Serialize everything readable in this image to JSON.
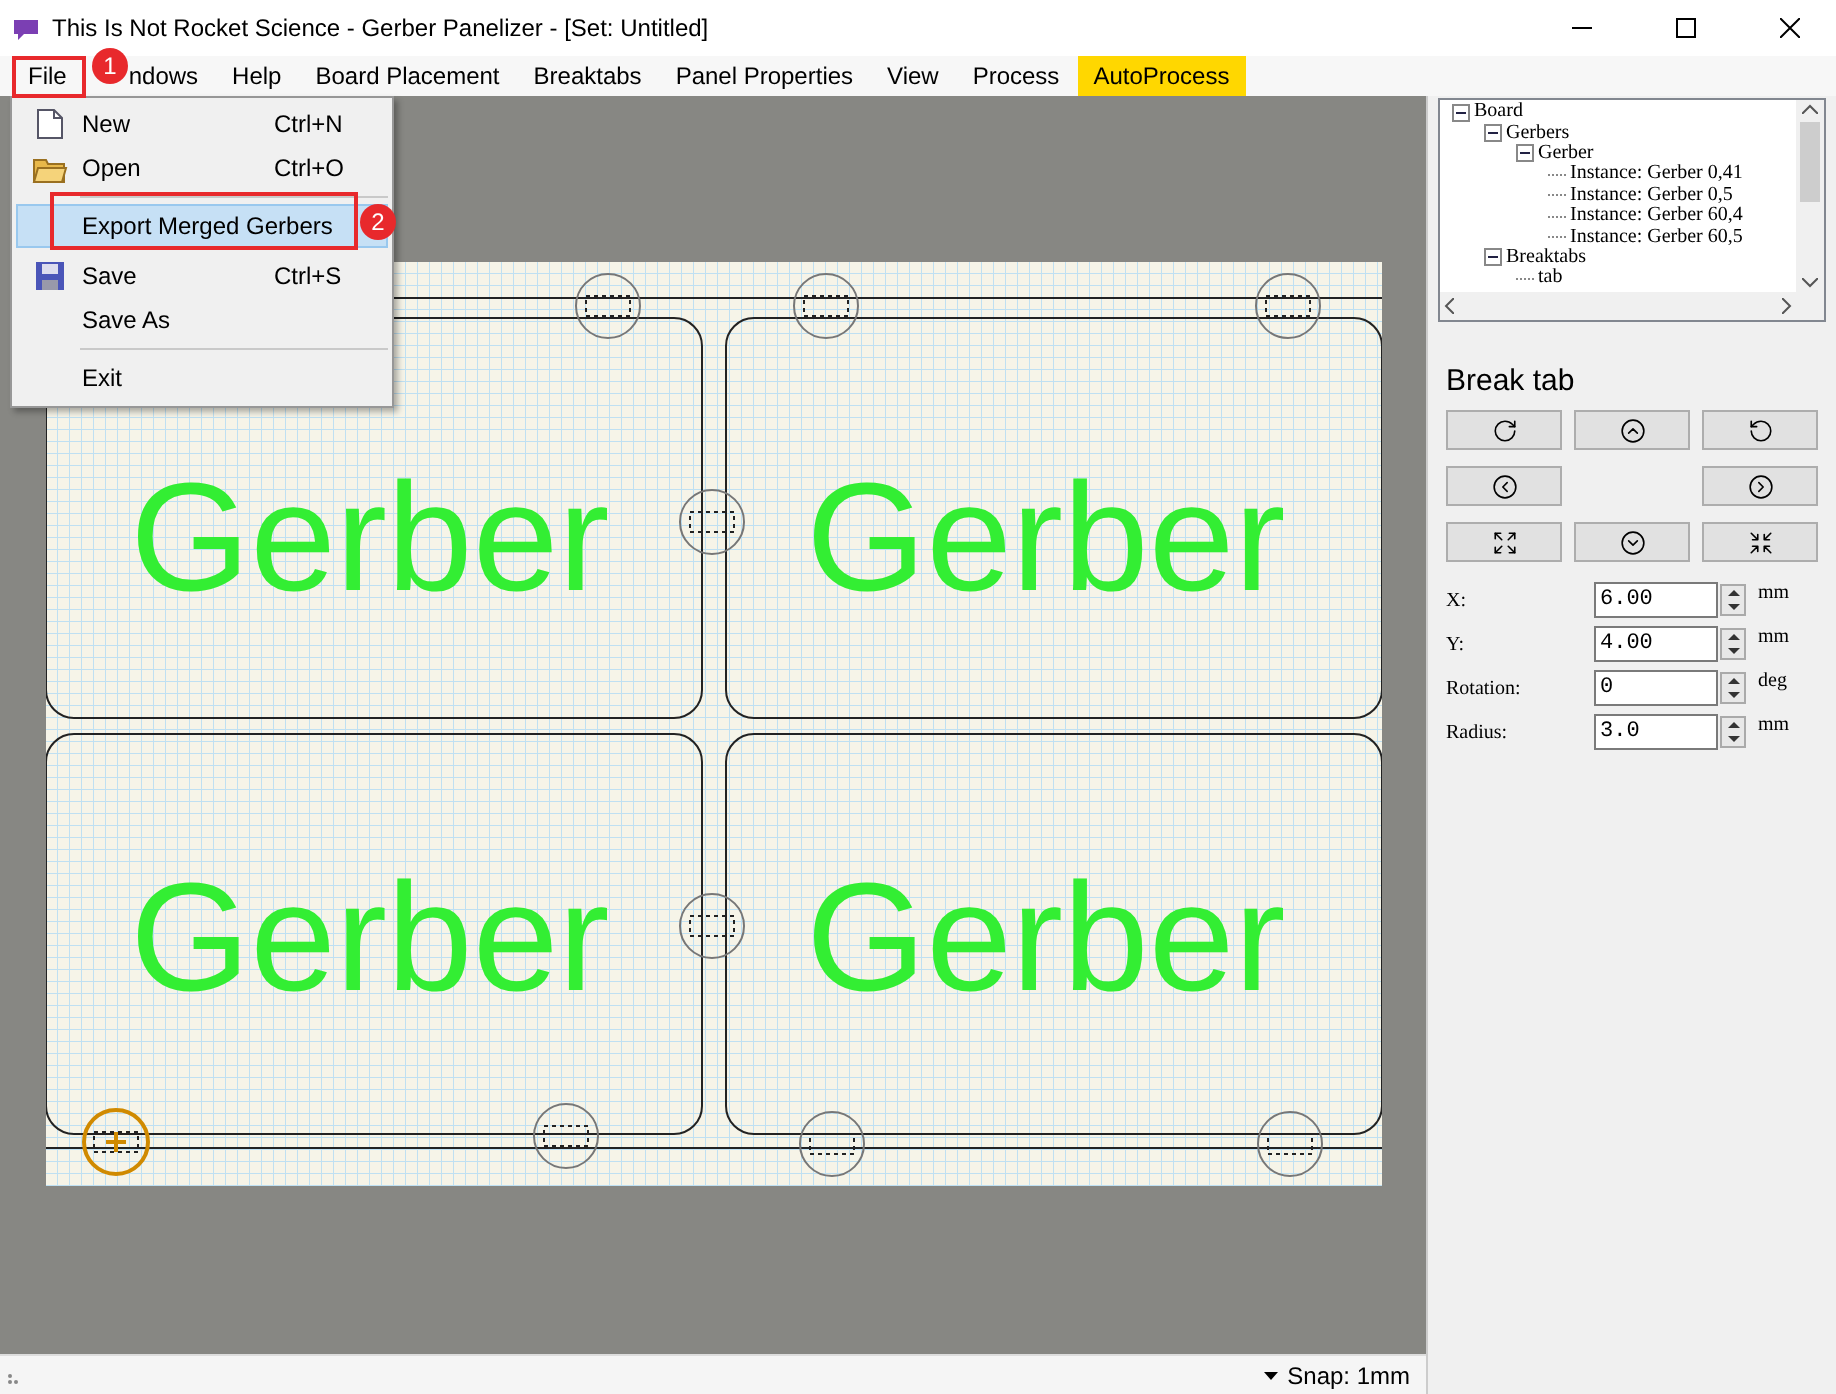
{
  "window": {
    "title": "This Is Not Rocket Science - Gerber Panelizer - [Set: Untitled]"
  },
  "menu": [
    {
      "label": "File",
      "highlighted": false
    },
    {
      "label": "ndows",
      "highlighted": false
    },
    {
      "label": "Help",
      "highlighted": false
    },
    {
      "label": "Board Placement",
      "highlighted": false
    },
    {
      "label": "Breaktabs",
      "highlighted": false
    },
    {
      "label": "Panel Properties",
      "highlighted": false
    },
    {
      "label": "View",
      "highlighted": false
    },
    {
      "label": "Process",
      "highlighted": false
    },
    {
      "label": "AutoProcess",
      "highlighted": true
    }
  ],
  "file_menu": [
    {
      "kind": "item",
      "label": "New",
      "shortcut": "Ctrl+N",
      "selected": false
    },
    {
      "kind": "item",
      "label": "Open",
      "shortcut": "Ctrl+O",
      "selected": false
    },
    {
      "kind": "separator"
    },
    {
      "kind": "item",
      "label": "Export Merged Gerbers",
      "selected": true
    },
    {
      "kind": "item",
      "label": "Save",
      "shortcut": "Ctrl+S",
      "selected": false
    },
    {
      "kind": "item",
      "label": "Save As",
      "selected": false
    },
    {
      "kind": "separator"
    },
    {
      "kind": "item",
      "label": "Exit",
      "selected": false
    }
  ],
  "annotations": [
    {
      "label": "1"
    },
    {
      "label": "2"
    }
  ],
  "canvas": {
    "boards": [
      {
        "label": "Gerber"
      },
      {
        "label": "Gerber"
      },
      {
        "label": "Gerber"
      },
      {
        "label": "Gerber"
      }
    ],
    "breaktabs": [
      {
        "selected": false
      },
      {
        "selected": false
      },
      {
        "selected": false
      },
      {
        "selected": false
      },
      {
        "selected": false
      },
      {
        "selected": true
      },
      {
        "selected": false
      },
      {
        "selected": false
      },
      {
        "selected": false
      }
    ]
  },
  "tree": [
    {
      "label": "Board",
      "expanded": true,
      "children": [
        {
          "label": "Gerbers",
          "expanded": true,
          "children": [
            {
              "label": "Gerber",
              "expanded": true,
              "children": [
                {
                  "label": "Instance: Gerber 0,41"
                },
                {
                  "label": "Instance: Gerber 0,5"
                },
                {
                  "label": "Instance: Gerber 60,4"
                },
                {
                  "label": "Instance: Gerber 60,5"
                }
              ]
            }
          ]
        },
        {
          "label": "Breaktabs",
          "expanded": true,
          "children": [
            {
              "label": "tab"
            }
          ]
        }
      ]
    }
  ],
  "properties": {
    "title": "Break tab",
    "fields": [
      {
        "label": "X:",
        "value": "6.00",
        "unit": "mm"
      },
      {
        "label": "Y:",
        "value": "4.00",
        "unit": "mm"
      },
      {
        "label": "Rotation:",
        "value": "0",
        "unit": "deg"
      },
      {
        "label": "Radius:",
        "value": "3.0",
        "unit": "mm"
      }
    ]
  },
  "status_bar": {
    "snap": "Snap: 1mm"
  }
}
